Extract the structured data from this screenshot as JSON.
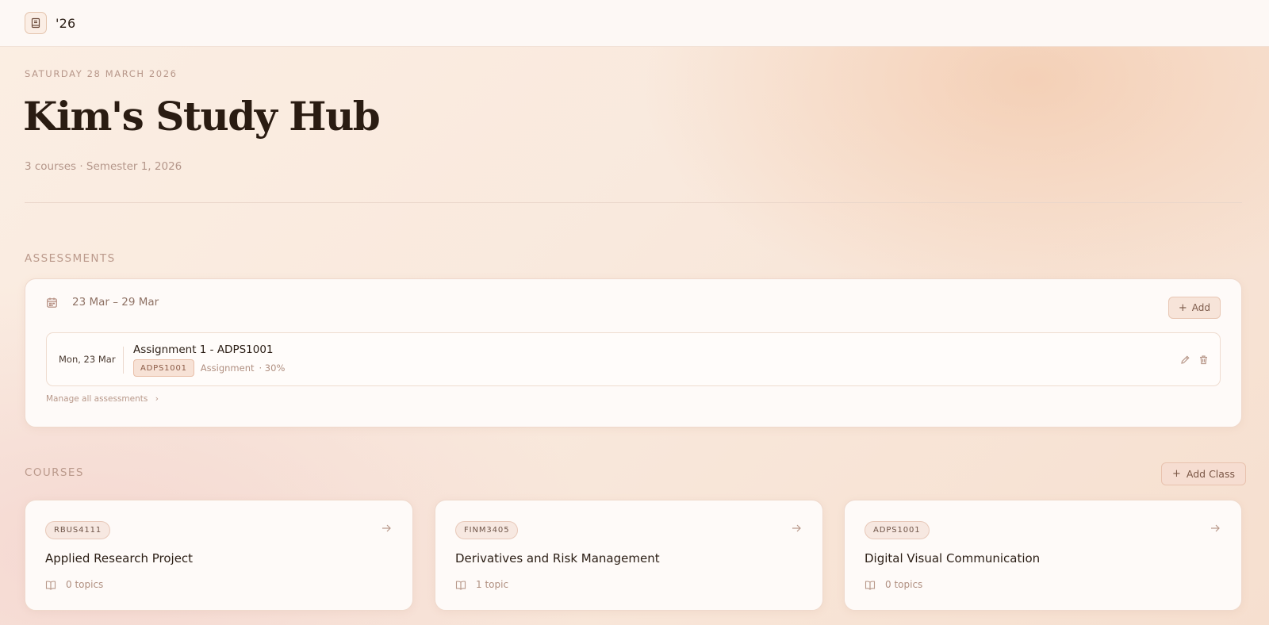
{
  "header": {
    "brand": "'26"
  },
  "hero": {
    "date": "SATURDAY 28 MARCH 2026",
    "title": "Kim's Study Hub",
    "subtitle": "3 courses · Semester 1, 2026"
  },
  "assessments": {
    "section_label": "ASSESSMENTS",
    "week_range": "23 Mar – 29 Mar",
    "add_label": "Add",
    "items": [
      {
        "date": "Mon, 23 Mar",
        "title": "Assignment 1 - ADPS1001",
        "code": "ADPS1001",
        "type": "Assignment",
        "weight": "· 30%"
      }
    ],
    "manage_link": "Manage all assessments",
    "manage_chevron": "›"
  },
  "courses": {
    "section_label": "COURSES",
    "add_label": "Add Class",
    "items": [
      {
        "code": "RBUS4111",
        "name": "Applied Research Project",
        "topics": "0 topics"
      },
      {
        "code": "FINM3405",
        "name": "Derivatives and Risk Management",
        "topics": "1 topic"
      },
      {
        "code": "ADPS1001",
        "name": "Digital Visual Communication",
        "topics": "0 topics"
      }
    ]
  },
  "icons": {
    "brand": "notebook-icon",
    "calendar": "calendar-icon",
    "edit": "pencil-icon",
    "delete": "trash-icon",
    "course_open": "arrow-right-icon",
    "topics": "book-open-icon"
  },
  "colors": {
    "accent": "#e8c2ae",
    "text": "#2a1d14",
    "muted": "#b4968a"
  }
}
